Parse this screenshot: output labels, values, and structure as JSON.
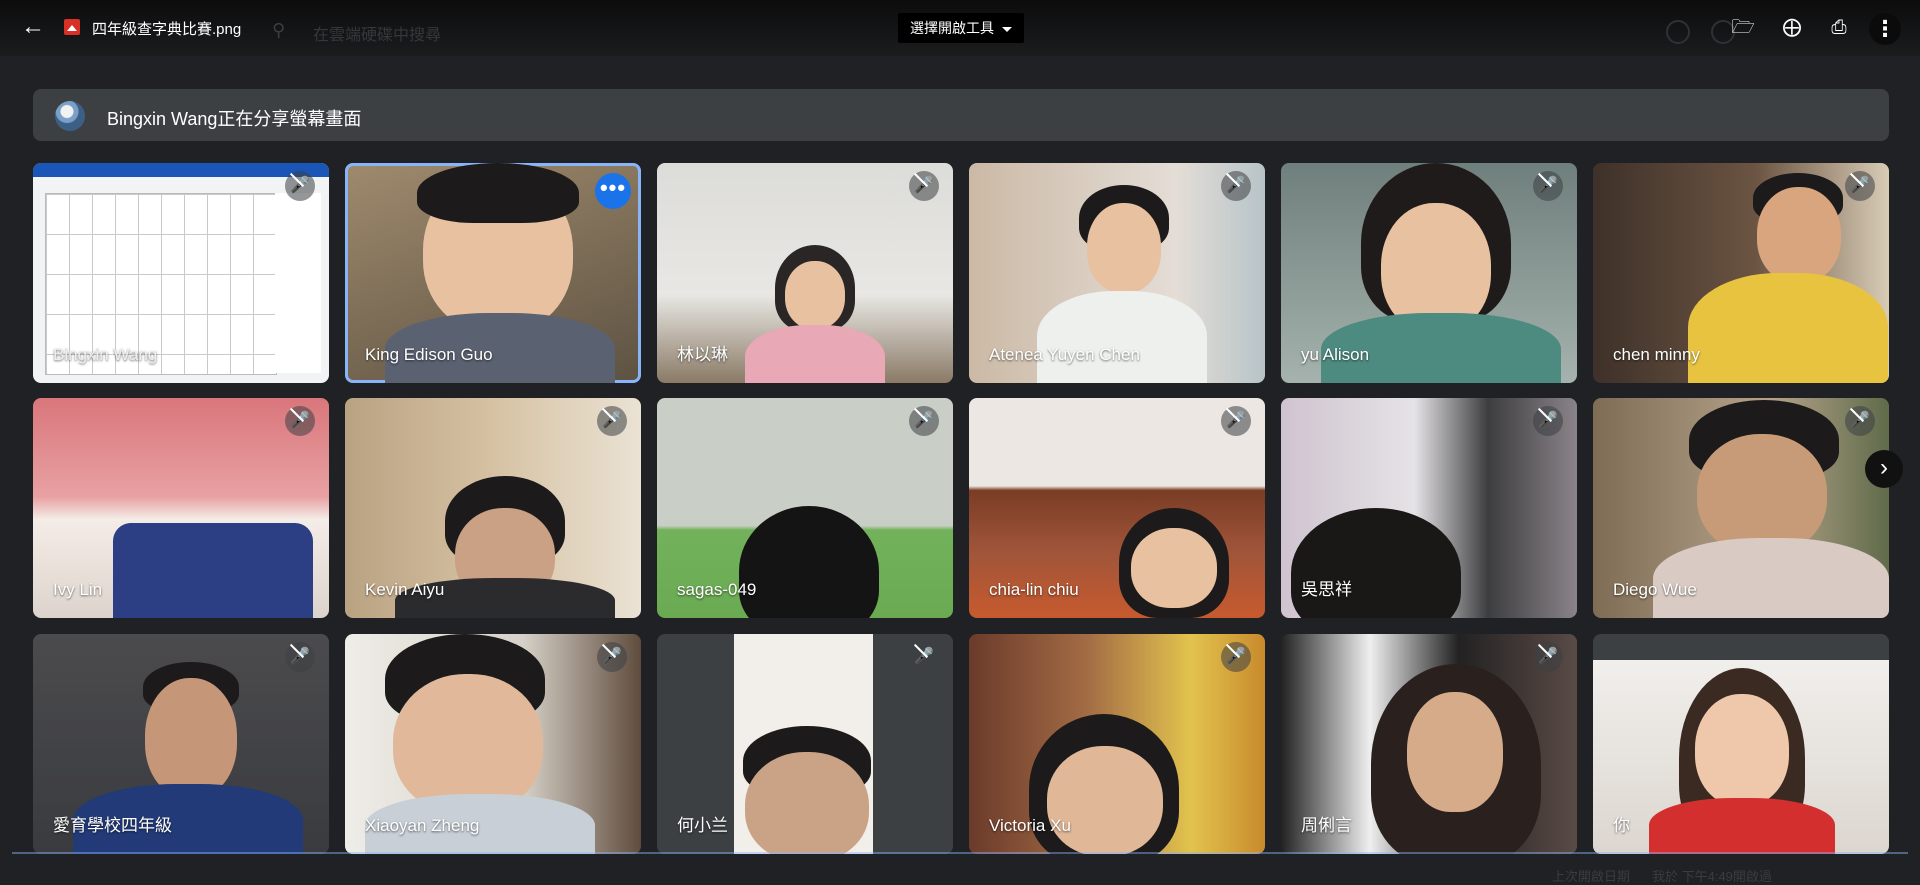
{
  "viewer": {
    "filename": "四年級查字典比賽.png",
    "open_with_label": "選擇開啟工具",
    "background_search_placeholder": "在雲端硬碟中搜尋"
  },
  "banner": {
    "text": "Bingxin Wang正在分享螢幕畫面"
  },
  "participants": [
    {
      "name": "Bingxin Wang"
    },
    {
      "name": "King Edison Guo"
    },
    {
      "name": "林以琳"
    },
    {
      "name": "Atenea Yuyen Chen"
    },
    {
      "name": "yu Alison"
    },
    {
      "name": "chen minny"
    },
    {
      "name": "Ivy Lin"
    },
    {
      "name": "Kevin Aiyu"
    },
    {
      "name": "sagas-049"
    },
    {
      "name": "chia-lin chiu"
    },
    {
      "name": "吳思祥"
    },
    {
      "name": "Diego Wue"
    },
    {
      "name": "愛育學校四年級"
    },
    {
      "name": "Xiaoyan Zheng"
    },
    {
      "name": "何小兰"
    },
    {
      "name": "Victoria Xu"
    },
    {
      "name": "周俐言"
    },
    {
      "name": "你"
    }
  ],
  "footer_ghost": {
    "left": "上次開啟日期",
    "right": "我於 下午4:49開啟過"
  },
  "icons": {
    "back": "arrow-left-icon",
    "add_to_drive": "add-to-drive-icon",
    "comment": "add-comment-icon",
    "print": "print-icon",
    "more": "more-vert-icon",
    "mic_off": "mic-off-icon",
    "next": "chevron-right-icon"
  }
}
